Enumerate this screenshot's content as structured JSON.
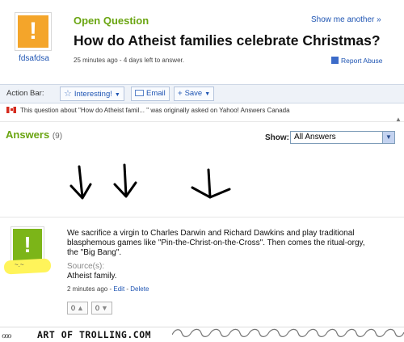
{
  "question": {
    "section_label": "Open Question",
    "show_another": "Show me another »",
    "title": "How do Atheist families celebrate Christmas?",
    "meta": "25 minutes ago - 4 days left to answer.",
    "report_abuse": "Report Abuse",
    "asker_name": "fdsafdsa"
  },
  "action_bar": {
    "label": "Action Bar:",
    "interesting": "Interesting!",
    "email": "Email",
    "save": "Save"
  },
  "canada_notice": "This question about \"How do Atheist famil... \" was originally asked on Yahoo! Answers Canada",
  "answers": {
    "heading": "Answers",
    "count": "(9)",
    "show_label": "Show:",
    "show_value": "All Answers"
  },
  "answer": {
    "text": "We sacrifice a virgin to Charles Darwin and Richard Dawkins and play traditional blasphemous games like \"Pin-the-Christ-on-the-Cross\". Then comes the ritual-orgy, the \"Big Bang\".",
    "source_label": "Source(s):",
    "source": "Atheist family.",
    "time": "2 minutes ago",
    "edit": "Edit",
    "delete": "Delete",
    "thumbs_up": "0",
    "thumbs_down": "0",
    "author_blur": "~.~"
  },
  "footer": {
    "brand": "ART OF TROLLING.COM",
    "swirls": "ℴℴℴ"
  },
  "colors": {
    "green": "#6aa511",
    "orange": "#f4a52a",
    "link": "#1f55b3",
    "highlight": "#fff45a"
  }
}
